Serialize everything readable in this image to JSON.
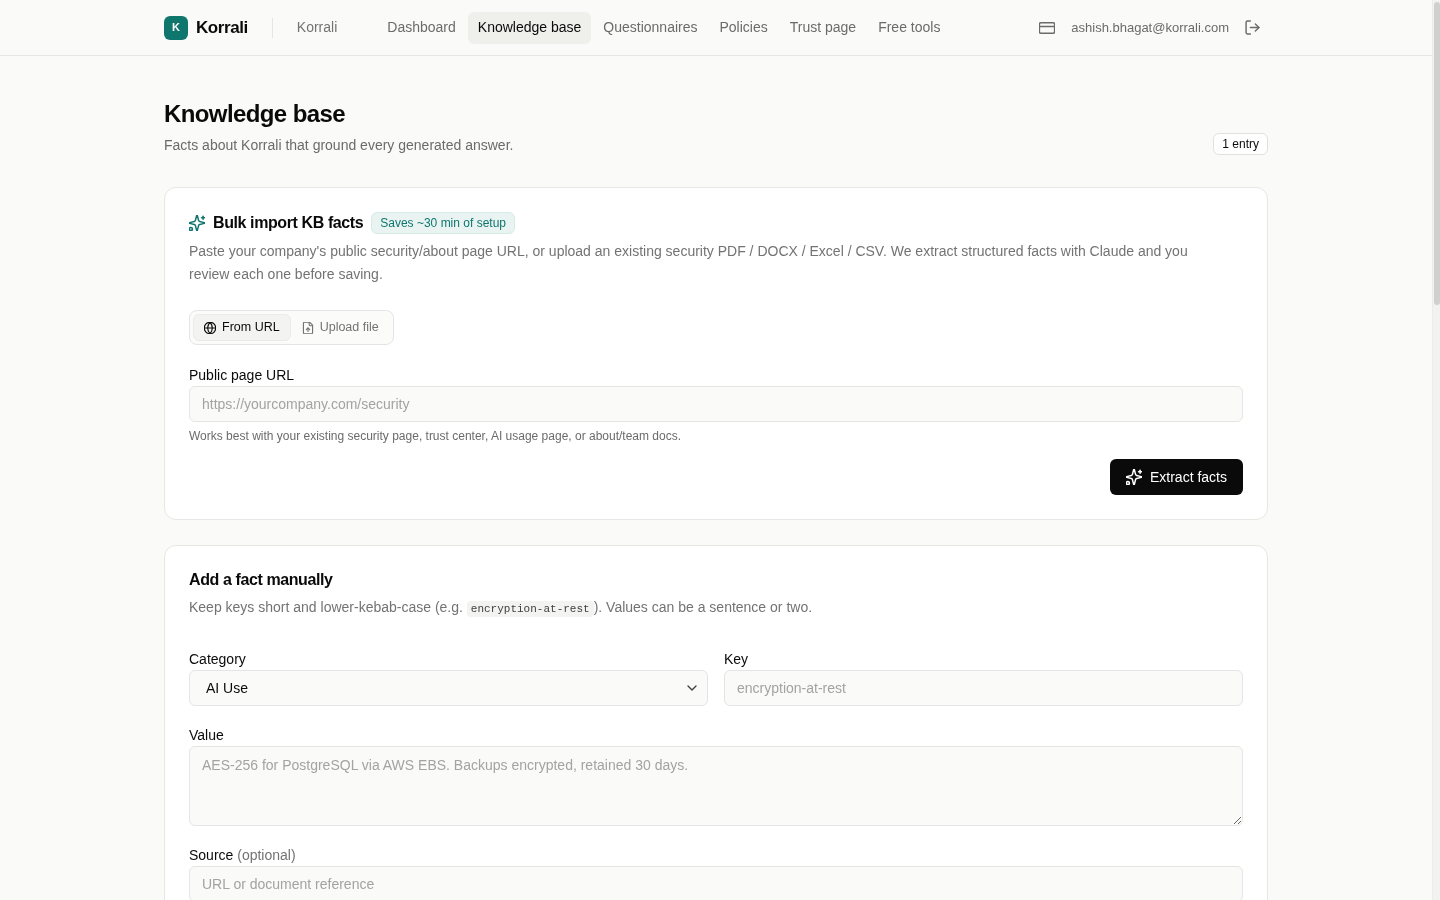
{
  "header": {
    "logo": {
      "letter": "K",
      "name": "Korrali"
    },
    "workspace": "Korrali",
    "nav": [
      {
        "label": "Dashboard",
        "selected": false
      },
      {
        "label": "Knowledge base",
        "selected": true
      },
      {
        "label": "Questionnaires",
        "selected": false
      },
      {
        "label": "Policies",
        "selected": false
      },
      {
        "label": "Trust page",
        "selected": false
      },
      {
        "label": "Free tools",
        "selected": false
      }
    ],
    "user_email": "ashish.bhagat@korrali.com"
  },
  "page": {
    "title": "Knowledge base",
    "subtitle": "Facts about Korrali that ground every generated answer.",
    "entry_count": "1 entry"
  },
  "bulk_import": {
    "title": "Bulk import KB facts",
    "badge": "Saves ~30 min of setup",
    "description": "Paste your company's public security/about page URL, or upload an existing security PDF / DOCX / Excel / CSV. We extract structured facts with Claude and you review each one before saving.",
    "tabs": [
      {
        "kind": "url",
        "label": "From URL",
        "selected": true
      },
      {
        "kind": "file",
        "label": "Upload file",
        "selected": false
      }
    ],
    "url_field": {
      "label": "Public page URL",
      "placeholder": "https://yourcompany.com/security",
      "help": "Works best with your existing security page, trust center, AI usage page, or about/team docs."
    },
    "submit_button": "Extract facts"
  },
  "manual_fact": {
    "title": "Add a fact manually",
    "description": [
      {
        "kind": "text",
        "text": "Keep keys short and lower-kebab-case (e.g. "
      },
      {
        "kind": "code",
        "text": "encryption-at-rest"
      },
      {
        "kind": "text",
        "text": "). Values can be a sentence or two."
      }
    ],
    "rows": [
      [
        {
          "kind": "select",
          "label": "Category",
          "value": "AI Use"
        },
        {
          "kind": "input",
          "label": "Key",
          "placeholder": "encryption-at-rest"
        }
      ],
      [
        {
          "kind": "textarea",
          "label": "Value",
          "placeholder": "AES-256 for PostgreSQL via AWS EBS. Backups encrypted, retained 30 days."
        }
      ],
      [
        {
          "kind": "input",
          "label": "Source",
          "hint": "(optional)",
          "placeholder": "URL or document reference"
        }
      ]
    ]
  }
}
